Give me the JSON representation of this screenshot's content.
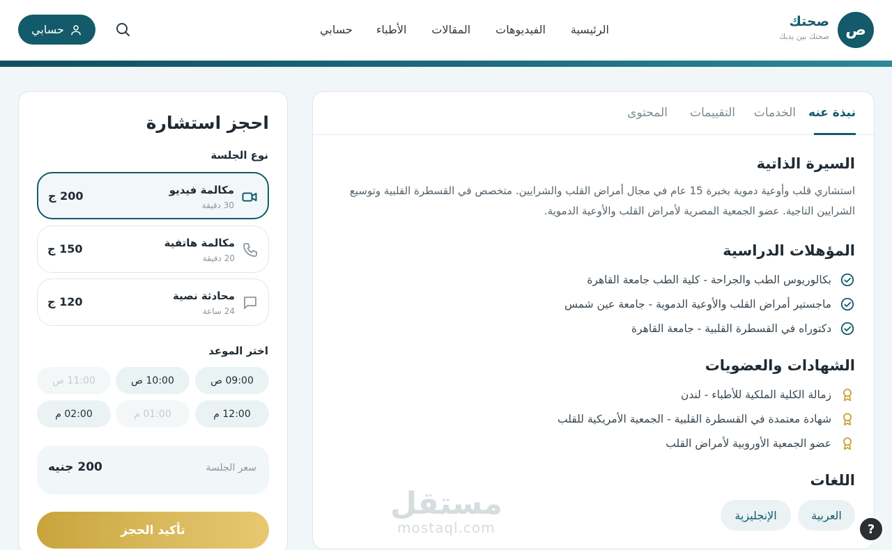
{
  "header": {
    "logo_letter": "ص",
    "logo_name": "صحتك",
    "logo_tagline": "صحتك بين يديك",
    "nav": [
      "الرئيسية",
      "الفيديوهات",
      "المقالات",
      "الأطباء",
      "حسابي"
    ],
    "account_label": "حسابي"
  },
  "profile": {
    "tabs": [
      "نبذة عنه",
      "الخدمات",
      "التقييمات",
      "المحتوى"
    ],
    "active_tab": "نبذة عنه",
    "bio_title": "السيرة الذاتية",
    "bio_text": "استشاري قلب وأوعية دموية بخبرة 15 عام في مجال أمراض القلب والشرايين. متخصص في القسطرة القلبية وتوسيع الشرايين التاجية. عضو الجمعية المصرية لأمراض القلب والأوعية الدموية.",
    "qualifications_title": "المؤهلات الدراسية",
    "qualifications": [
      "بكالوريوس الطب والجراحة - كلية الطب جامعة القاهرة",
      "ماجستير أمراض القلب والأوعية الدموية - جامعة عين شمس",
      "دكتوراه في القسطرة القلبية - جامعة القاهرة"
    ],
    "certificates_title": "الشهادات والعضويات",
    "certificates": [
      "زمالة الكلية الملكية للأطباء - لندن",
      "شهادة معتمدة في القسطرة القلبية - الجمعية الأمريكية للقلب",
      "عضو الجمعية الأوروبية لأمراض القلب"
    ],
    "languages_title": "اللغات",
    "languages": [
      "العربية",
      "الإنجليزية"
    ]
  },
  "booking": {
    "title": "احجز استشارة",
    "session_type_label": "نوع الجلسة",
    "sessions": [
      {
        "name": "مكالمة فيديو",
        "duration": "30 دقيقة",
        "price": "200 ج",
        "icon": "video-icon",
        "selected": true
      },
      {
        "name": "مكالمة هاتفية",
        "duration": "20 دقيقة",
        "price": "150 ج",
        "icon": "phone-icon",
        "selected": false
      },
      {
        "name": "محادثة نصية",
        "duration": "24 ساعة",
        "price": "120 ج",
        "icon": "chat-icon",
        "selected": false
      }
    ],
    "time_label": "اختر الموعد",
    "slots": [
      {
        "time": "09:00 ص",
        "available": true
      },
      {
        "time": "10:00 ص",
        "available": true
      },
      {
        "time": "11:00 ص",
        "available": false
      },
      {
        "time": "12:00 م",
        "available": true
      },
      {
        "time": "01:00 م",
        "available": false
      },
      {
        "time": "02:00 م",
        "available": true
      }
    ],
    "price_label": "سعر الجلسة",
    "price_value": "200 جنيه",
    "confirm_label": "تأكيد الحجز"
  },
  "watermark": {
    "ar": "مستقل",
    "en": "mostaql.com"
  },
  "help_label": "?",
  "colors": {
    "primary": "#135a6a",
    "gold": "#d8b85a",
    "background": "#f1f6f8"
  }
}
